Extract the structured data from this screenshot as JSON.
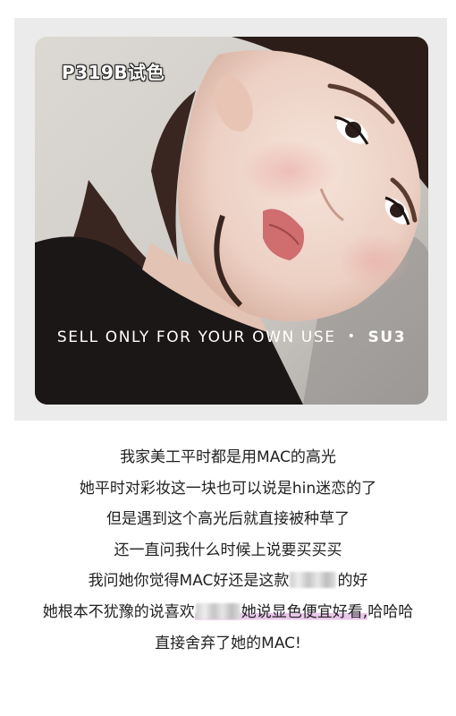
{
  "photo": {
    "shade_tag": "P319B试色",
    "watermark_text": "SELL ONLY FOR YOUR OWN USE",
    "watermark_separator": "•",
    "watermark_brand": "SU3",
    "subject": "portrait-photo"
  },
  "caption": {
    "line1": "我家美工平时都是用MAC的高光",
    "line2": "她平时对彩妆这一块也可以说是hin迷恋的了",
    "line3": "但是遇到这个高光后就直接被种草了",
    "line4": "还一直问我什么时候上说要买买买",
    "line5_before": "我问她你觉得MAC好还是这款",
    "line5_after": "的好",
    "line6_before": "她根本不犹豫的说喜欢",
    "line6_highlight": "她说显色便宜好看,",
    "line6_after": "哈哈哈",
    "line7": "直接舍弃了她的MAC!"
  },
  "colors": {
    "highlight": "#e9c7ea",
    "text": "#222222",
    "frame": "#ebebeb"
  }
}
